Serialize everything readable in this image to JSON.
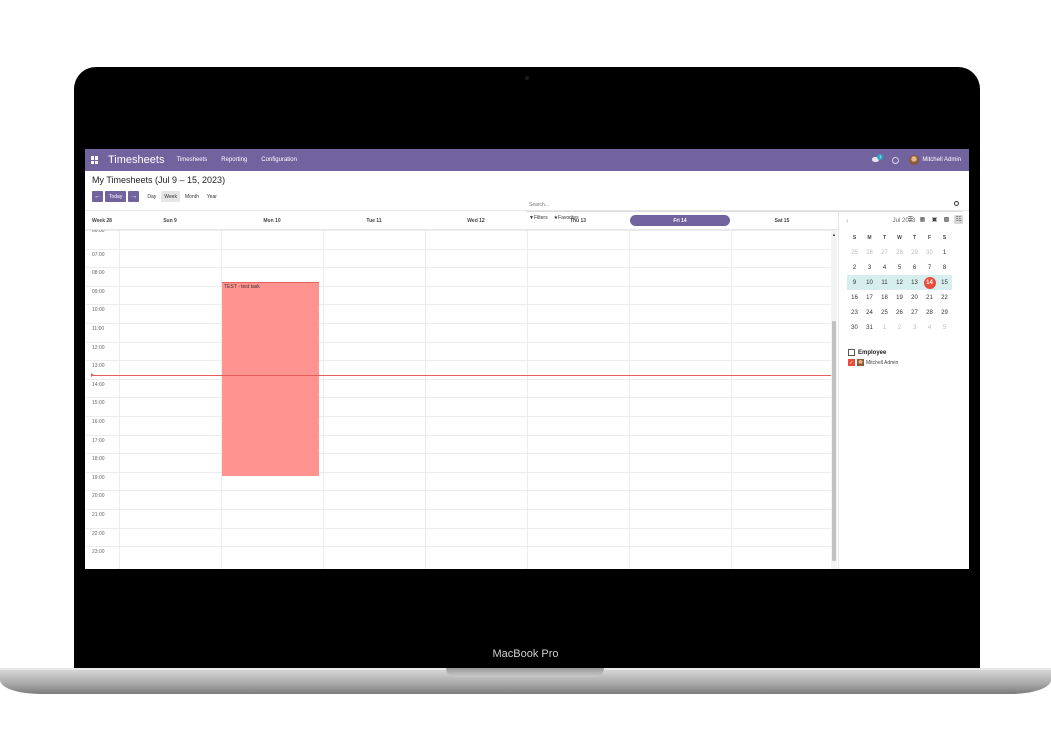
{
  "device": {
    "brand_label": "MacBook Pro"
  },
  "navbar": {
    "app_title": "Timesheets",
    "menu": [
      "Timesheets",
      "Reporting",
      "Configuration"
    ],
    "chat_badge": "1",
    "user_name": "Mitchell Admin",
    "color": "#71639e"
  },
  "control_panel": {
    "title": "My Timesheets (Jul 9 – 15, 2023)",
    "today_label": "Today",
    "prev_icon": "arrow-left-icon",
    "next_icon": "arrow-right-icon",
    "scales": [
      {
        "label": "Day",
        "active": false
      },
      {
        "label": "Week",
        "active": true
      },
      {
        "label": "Month",
        "active": false
      },
      {
        "label": "Year",
        "active": false
      }
    ],
    "search_placeholder": "Search...",
    "filters_label": "Filters",
    "favorites_label": "Favorites"
  },
  "calendar": {
    "week_label": "Week 28",
    "days": [
      {
        "label": "Sun 9",
        "today": false
      },
      {
        "label": "Mon 10",
        "today": false
      },
      {
        "label": "Tue 11",
        "today": false
      },
      {
        "label": "Wed 12",
        "today": false
      },
      {
        "label": "Thu 13",
        "today": false
      },
      {
        "label": "Fri 14",
        "today": true
      },
      {
        "label": "Sat 15",
        "today": false
      }
    ],
    "hours": [
      "06:00",
      "07:00",
      "08:00",
      "09:00",
      "10:00",
      "11:00",
      "12:00",
      "13:00",
      "14:00",
      "15:00",
      "16:00",
      "17:00",
      "18:00",
      "19:00",
      "20:00",
      "21:00",
      "22:00",
      "23:00"
    ],
    "event": {
      "title": "TEST - test task",
      "day": "Mon 10",
      "color": "#fe9390"
    },
    "now_line_color": "#e55e5e"
  },
  "mini_calendar": {
    "month_label": "Jul 2023",
    "dow": [
      "S",
      "M",
      "T",
      "W",
      "T",
      "F",
      "S"
    ],
    "weeks": [
      [
        "25",
        "26",
        "27",
        "28",
        "29",
        "30",
        "1"
      ],
      [
        "2",
        "3",
        "4",
        "5",
        "6",
        "7",
        "8"
      ],
      [
        "9",
        "10",
        "11",
        "12",
        "13",
        "14",
        "15"
      ],
      [
        "16",
        "17",
        "18",
        "19",
        "20",
        "21",
        "22"
      ],
      [
        "23",
        "24",
        "25",
        "26",
        "27",
        "28",
        "29"
      ],
      [
        "30",
        "31",
        "1",
        "2",
        "3",
        "4",
        "5"
      ]
    ],
    "today": "14",
    "highlight_color": "#d6efee",
    "today_color": "#e74c3c"
  },
  "side_filter": {
    "title": "Employee",
    "items": [
      {
        "label": "Mitchell Admin",
        "checked": true
      }
    ]
  }
}
